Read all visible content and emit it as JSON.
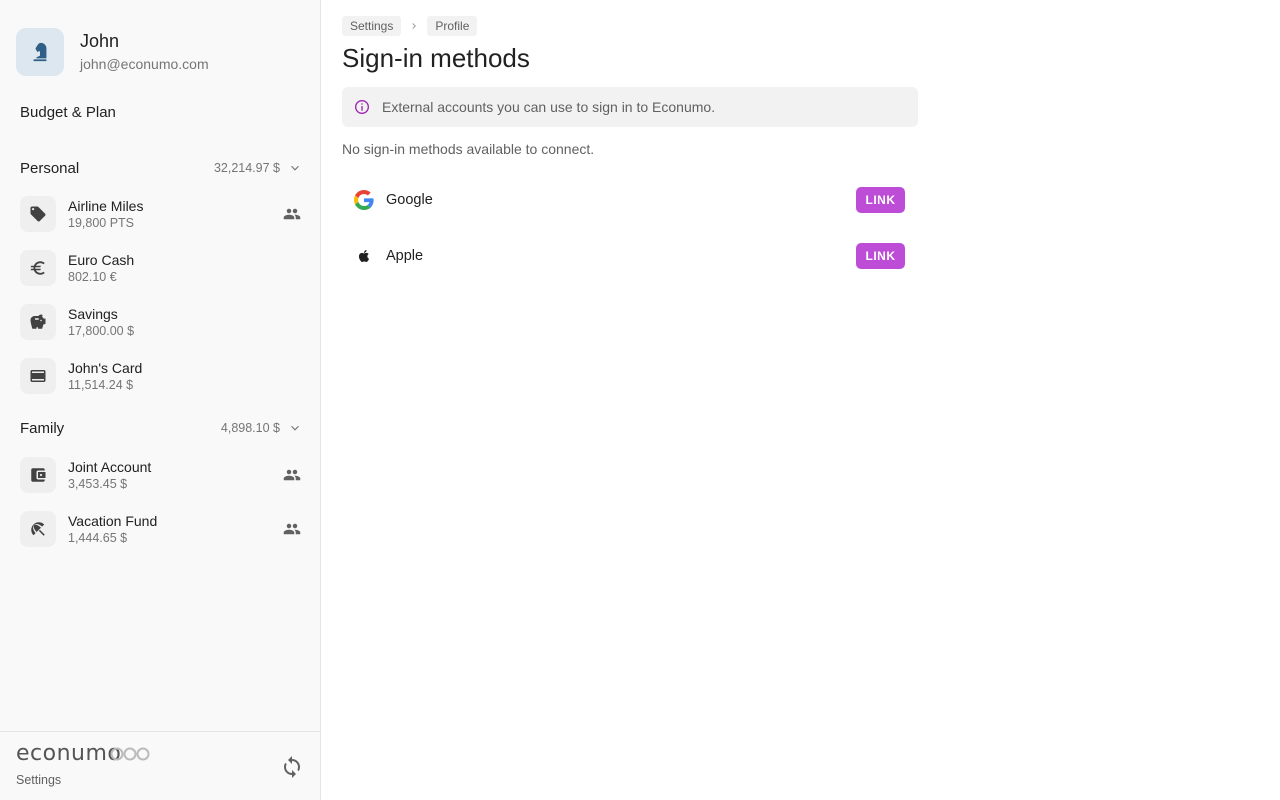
{
  "user": {
    "name": "John",
    "email": "john@econumo.com"
  },
  "nav": {
    "budget_label": "Budget & Plan"
  },
  "groups": [
    {
      "name": "Personal",
      "total": "32,214.97 $",
      "accounts": [
        {
          "name": "Airline Miles",
          "balance": "19,800 PTS",
          "icon": "tag-icon",
          "shared": true
        },
        {
          "name": "Euro Cash",
          "balance": "802.10 €",
          "icon": "euro-icon",
          "shared": false
        },
        {
          "name": "Savings",
          "balance": "17,800.00 $",
          "icon": "piggy-bank-icon",
          "shared": false
        },
        {
          "name": "John's Card",
          "balance": "11,514.24 $",
          "icon": "credit-card-icon",
          "shared": false
        }
      ]
    },
    {
      "name": "Family",
      "total": "4,898.10 $",
      "accounts": [
        {
          "name": "Joint Account",
          "balance": "3,453.45 $",
          "icon": "wallet-icon",
          "shared": true
        },
        {
          "name": "Vacation Fund",
          "balance": "1,444.65 $",
          "icon": "beach-umbrella-icon",
          "shared": true
        }
      ]
    }
  ],
  "footer": {
    "logo": "econumo",
    "settings_label": "Settings"
  },
  "breadcrumbs": [
    "Settings",
    "Profile"
  ],
  "page": {
    "title": "Sign-in methods",
    "info": "External accounts you can use to sign in to Econumo.",
    "empty": "No sign-in methods available to connect."
  },
  "methods": [
    {
      "name": "Google",
      "icon": "google-icon",
      "action": "LINK"
    },
    {
      "name": "Apple",
      "icon": "apple-icon",
      "action": "LINK"
    }
  ],
  "colors": {
    "accent": "#bd4dd6",
    "info_icon": "#9c27b0",
    "sidebar_bg": "#f9f9f9"
  }
}
